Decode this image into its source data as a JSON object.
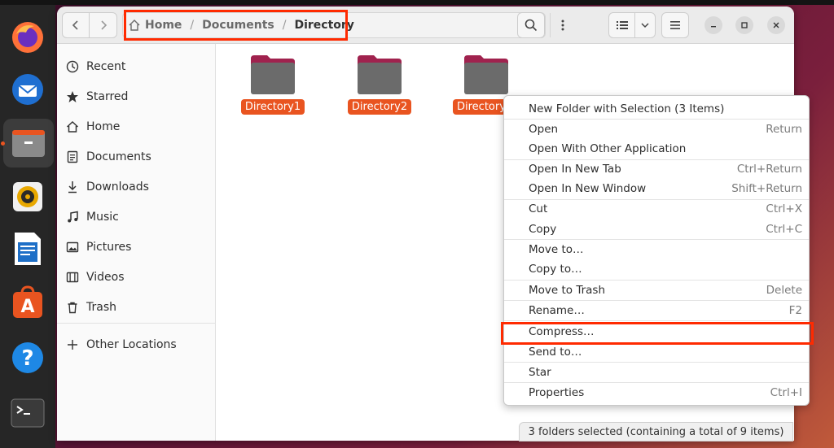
{
  "window": {
    "breadcrumb": [
      "Home",
      "Documents",
      "Directory"
    ]
  },
  "sidebar": {
    "items": [
      {
        "label": "Recent",
        "icon": "clock-icon"
      },
      {
        "label": "Starred",
        "icon": "star-icon"
      },
      {
        "label": "Home",
        "icon": "home-icon"
      },
      {
        "label": "Documents",
        "icon": "document-icon"
      },
      {
        "label": "Downloads",
        "icon": "download-icon"
      },
      {
        "label": "Music",
        "icon": "music-icon"
      },
      {
        "label": "Pictures",
        "icon": "picture-icon"
      },
      {
        "label": "Videos",
        "icon": "video-icon"
      },
      {
        "label": "Trash",
        "icon": "trash-icon"
      }
    ],
    "other_locations": "Other Locations"
  },
  "content": {
    "folders": [
      "Directory1",
      "Directory2",
      "Directory"
    ]
  },
  "context_menu": {
    "items": [
      {
        "label": "New Folder with Selection (3 Items)",
        "shortcut": ""
      },
      {
        "label": "Open",
        "shortcut": "Return"
      },
      {
        "label": "Open With Other Application",
        "shortcut": ""
      },
      {
        "label": "Open In New Tab",
        "shortcut": "Ctrl+Return"
      },
      {
        "label": "Open In New Window",
        "shortcut": "Shift+Return"
      },
      {
        "label": "Cut",
        "shortcut": "Ctrl+X"
      },
      {
        "label": "Copy",
        "shortcut": "Ctrl+C"
      },
      {
        "label": "Move to…",
        "shortcut": ""
      },
      {
        "label": "Copy to…",
        "shortcut": ""
      },
      {
        "label": "Move to Trash",
        "shortcut": "Delete"
      },
      {
        "label": "Rename…",
        "shortcut": "F2"
      },
      {
        "label": "Compress…",
        "shortcut": ""
      },
      {
        "label": "Send to…",
        "shortcut": ""
      },
      {
        "label": "Star",
        "shortcut": ""
      },
      {
        "label": "Properties",
        "shortcut": "Ctrl+I"
      }
    ]
  },
  "status": {
    "text": "3 folders selected  (containing a total of 9 items)"
  },
  "colors": {
    "accent": "#e95420",
    "highlight": "#ff2a00",
    "folder": "#6b6b6b",
    "folder_tab": "#a0224e"
  }
}
